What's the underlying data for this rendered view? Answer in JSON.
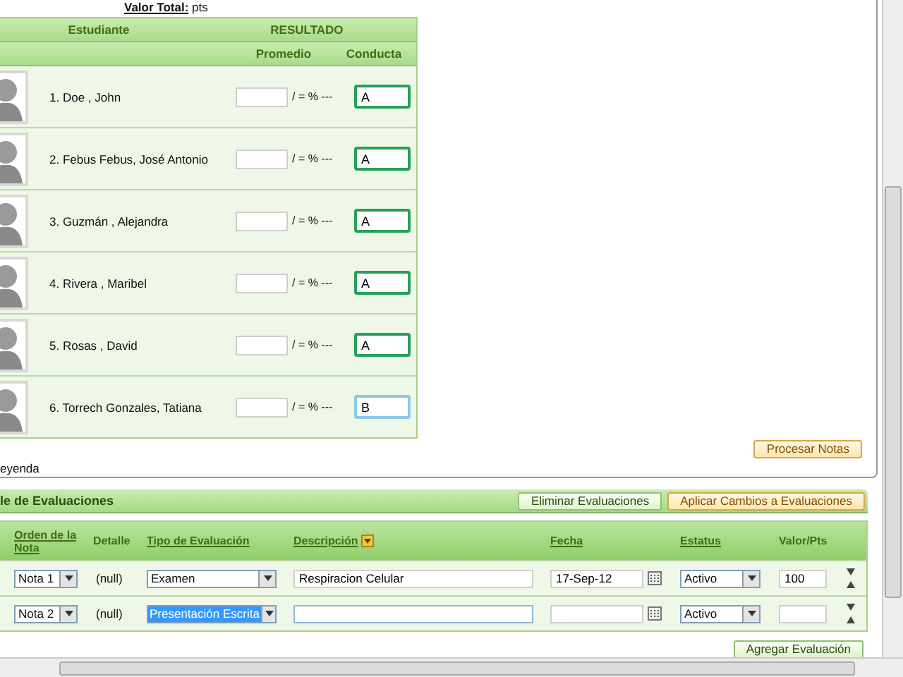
{
  "summary": {
    "label": "Valor Total:",
    "unit": "pts"
  },
  "grades_table": {
    "columns": [
      "Estudiante",
      "RESULTADO"
    ],
    "subcolumns": [
      "Promedio",
      "Conducta"
    ],
    "rows": [
      {
        "name": "1. Doe , John",
        "average_suffix": "/ = % ---",
        "conduct": "A",
        "focused": false
      },
      {
        "name": "2. Febus Febus, José Antonio",
        "average_suffix": "/ = % ---",
        "conduct": "A",
        "focused": false
      },
      {
        "name": "3. Guzmán , Alejandra",
        "average_suffix": "/ = % ---",
        "conduct": "A",
        "focused": false
      },
      {
        "name": "4. Rivera , Maribel",
        "average_suffix": "/ = % ---",
        "conduct": "A",
        "focused": false
      },
      {
        "name": "5. Rosas , David",
        "average_suffix": "/ = % ---",
        "conduct": "A",
        "focused": false
      },
      {
        "name": "6. Torrech Gonzales, Tatiana",
        "average_suffix": "/ = % ---",
        "conduct": "B",
        "focused": true
      }
    ]
  },
  "process_button": "Procesar Notas",
  "legend": "eyenda",
  "evaluations": {
    "title": "le de Evaluaciones",
    "buttons": [
      {
        "label": "Eliminar Evaluaciones",
        "kind": "plain"
      },
      {
        "label": "Aplicar Cambios a Evaluaciones",
        "kind": "primary"
      }
    ],
    "columns": [
      {
        "label": "Orden de la Nota",
        "sortable": true,
        "menu": false
      },
      {
        "label": "Detalle",
        "sortable": false,
        "menu": false
      },
      {
        "label": "Tipo de Evaluación",
        "sortable": true,
        "menu": false
      },
      {
        "label": "Descripción",
        "sortable": true,
        "menu": true
      },
      {
        "label": "Fecha",
        "sortable": true,
        "menu": false
      },
      {
        "label": "Estatus",
        "sortable": true,
        "menu": false
      },
      {
        "label": "Valor/Pts",
        "sortable": false,
        "menu": false
      }
    ],
    "rows": [
      {
        "order": "Nota 1",
        "detail": "(null)",
        "type": "Examen",
        "type_selected": false,
        "description": "Respiracion Celular",
        "date": "17-Sep-12",
        "status": "Activo",
        "points": "100"
      },
      {
        "order": "Nota 2",
        "detail": "(null)",
        "type": "Presentación Escrita",
        "type_selected": true,
        "description": "",
        "date": "",
        "status": "Activo",
        "points": ""
      }
    ],
    "add_button": "Agregar Evaluación"
  }
}
